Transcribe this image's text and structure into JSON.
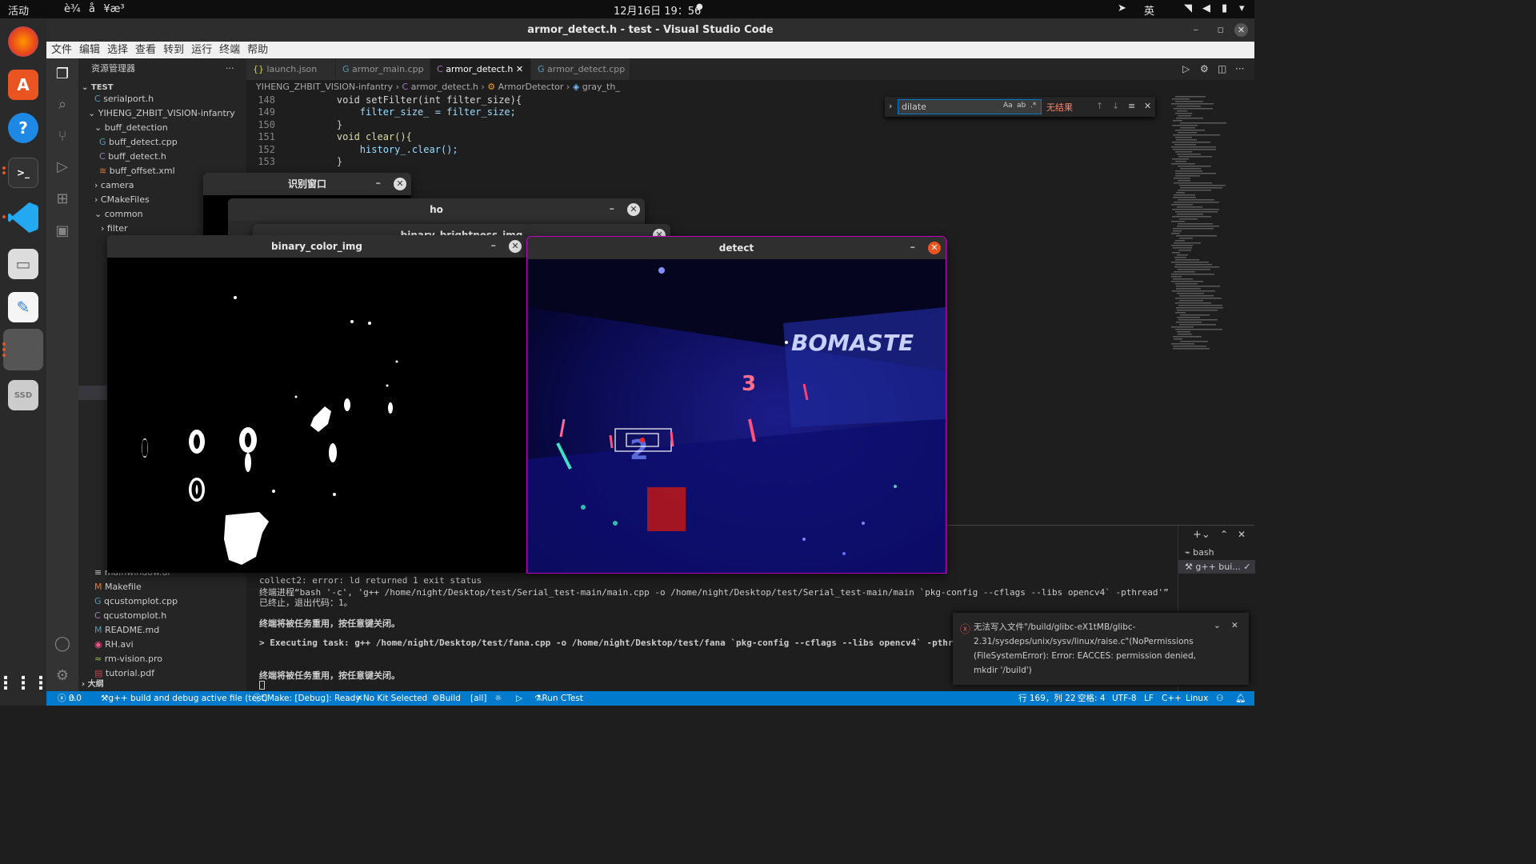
{
  "topbar": {
    "activities": "活动",
    "input_method_menu": "è¾å¥æ³",
    "clock": "12月16日 19：56",
    "lang": "英"
  },
  "window": {
    "title": "armor_detect.h - test - Visual Studio Code"
  },
  "menu": [
    "文件",
    "编辑",
    "选择",
    "查看",
    "转到",
    "运行",
    "终端",
    "帮助"
  ],
  "explorer": {
    "title": "资源管理器",
    "root": "TEST",
    "items": [
      {
        "label": "serialport.h",
        "icon": "C"
      },
      {
        "label": "YIHENG_ZHBIT_VISION-infantry",
        "icon": "chevron-down"
      },
      {
        "label": "buff_detection",
        "icon": "chevron-down"
      },
      {
        "label": "buff_detect.cpp",
        "icon": "C+"
      },
      {
        "label": "buff_detect.h",
        "icon": "C"
      },
      {
        "label": "buff_offset.xml",
        "icon": "rss"
      },
      {
        "label": "camera",
        "icon": "chevron-right"
      },
      {
        "label": "CMakeFiles",
        "icon": "chevron-right"
      },
      {
        "label": "common",
        "icon": "chevron-down"
      },
      {
        "label": "filter",
        "icon": "chevron-right"
      },
      {
        "label": "mainwindow.ui",
        "icon": "file"
      },
      {
        "label": "Makefile",
        "icon": "M"
      },
      {
        "label": "qcustomplot.cpp",
        "icon": "C+"
      },
      {
        "label": "qcustomplot.h",
        "icon": "C"
      },
      {
        "label": "README.md",
        "icon": "md"
      },
      {
        "label": "RH.avi",
        "icon": "video"
      },
      {
        "label": "rm-vision.pro",
        "icon": "pro"
      },
      {
        "label": "tutorial.pdf",
        "icon": "pdf"
      }
    ],
    "outline": "大纲"
  },
  "tabs": [
    {
      "label": "launch.json",
      "icon": "{}"
    },
    {
      "label": "armor_main.cpp",
      "icon": "C+"
    },
    {
      "label": "armor_detect.h",
      "icon": "C"
    },
    {
      "label": "armor_detect.cpp",
      "icon": "C+"
    }
  ],
  "breadcrumbs": [
    "YIHENG_ZHBIT_VISION-infantry",
    "armor_detect.h",
    "ArmorDetector",
    "gray_th_"
  ],
  "code": [
    {
      "n": "148",
      "text": "    void setFilter(int filter_size){"
    },
    {
      "n": "149",
      "text": "        filter_size_ = filter_size;"
    },
    {
      "n": "150",
      "text": "    }"
    },
    {
      "n": "151",
      "text": "    void clear(){"
    },
    {
      "n": "152",
      "text": "        history_.clear();"
    },
    {
      "n": "153",
      "text": "    }"
    }
  ],
  "find": {
    "query": "dilate",
    "result": "无结果",
    "opts": [
      "Aa",
      "ab",
      ".*"
    ]
  },
  "windows": {
    "w1": "识别窗口",
    "w2": "ho",
    "w3": "binary_brightness_img",
    "w4": "binary_color_img",
    "w5": "detect"
  },
  "terminal": {
    "lines": [
      "collect2: error: ld returned 1 exit status",
      "终端进程“bash '-c', 'g++ /home/night/Desktop/test/Serial_test-main/main.cpp -o /home/night/Desktop/test/Serial_test-main/main `pkg-config --cflags --libs opencv4` -pthread'”",
      "已终止，退出代码：1。",
      "",
      "终端将被任务重用，按任意键关闭。",
      "",
      "> Executing task: g++ /home/night/Desktop/test/fana.cpp -o /home/night/Desktop/test/fana `pkg-config --cflags --libs opencv4` -pthread",
      "",
      "",
      "终端将被任务重用，按任意键关闭。"
    ],
    "sessions": [
      "bash",
      "g++ bui..."
    ]
  },
  "notification": {
    "text": "无法写入文件\"/build/glibc-eX1tMB/glibc-2.31/sysdeps/unix/sysv/linux/raise.c\"(NoPermissions (FileSystemError): Error: EACCES: permission denied, mkdir '/build')"
  },
  "status": {
    "errors": "0",
    "warnings": "0",
    "task": "g++ build and debug active file (test)",
    "cmake": "CMake: [Debug]: Ready",
    "kit": "No Kit Selected",
    "build": "Build",
    "target": "[all]",
    "ctest": "Run CTest",
    "position": "行 169，列 22",
    "spaces": "空格: 4",
    "encoding": "UTF-8",
    "eol": "LF",
    "lang": "C++",
    "os": "Linux"
  },
  "detect": {
    "labels": [
      "BOMASTE",
      "3",
      "2"
    ]
  }
}
